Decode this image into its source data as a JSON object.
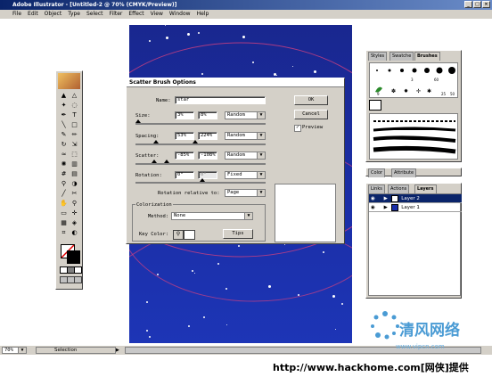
{
  "window": {
    "title": "Adobe Illustrator - [Untitled-2 @ 70% (CMYK/Preview)]"
  },
  "menu": [
    "File",
    "Edit",
    "Object",
    "Type",
    "Select",
    "Filter",
    "Effect",
    "View",
    "Window",
    "Help"
  ],
  "dialog": {
    "title": "Scatter Brush Options",
    "name_label": "Name:",
    "name_value": "star",
    "size_label": "Size:",
    "size_min": "3%",
    "size_max": "8%",
    "size_mode": "Random",
    "spacing_label": "Spacing:",
    "spacing_min": "53%",
    "spacing_max": "224%",
    "spacing_mode": "Random",
    "scatter_label": "Scatter:",
    "scatter_min": "-85%",
    "scatter_max": "-108%",
    "scatter_mode": "Random",
    "rotation_label": "Rotation:",
    "rotation_min": "0°",
    "rotation_max": "0°",
    "rotation_mode": "Fixed",
    "rotation_relative_label": "Rotation relative to:",
    "rotation_relative_value": "Page",
    "colorization_label": "Colorization",
    "method_label": "Method:",
    "method_value": "None",
    "key_color_label": "Key Color:",
    "tips_label": "Tips",
    "ok_label": "OK",
    "cancel_label": "Cancel",
    "preview_label": "Preview",
    "preview_checked": true
  },
  "brushes_panel": {
    "tabs": [
      "Styles",
      "Swatche",
      "Brushes"
    ],
    "active_tab": "Brushes",
    "sizes": [
      "3",
      "60",
      "9",
      "25",
      "50"
    ]
  },
  "layers_panel": {
    "tabs": [
      "Links",
      "Actions",
      "Layers"
    ],
    "active_tab": "Layers",
    "top_tabs": [
      "Color",
      "Attribute"
    ],
    "layers": [
      {
        "name": "Layer 2",
        "selected": true
      },
      {
        "name": "Layer 1",
        "selected": false
      }
    ]
  },
  "statusbar": {
    "zoom": "70%",
    "status": "Selection"
  },
  "footer": {
    "text": "http://www.hackhome.com[网侠]提供"
  },
  "watermark": {
    "text": "清风网络",
    "sub": "www.vipcn.com"
  },
  "colors": {
    "artboard": "#1b2fa8",
    "title_bar": "#0a246a",
    "watermark": "#4a9bd4"
  }
}
